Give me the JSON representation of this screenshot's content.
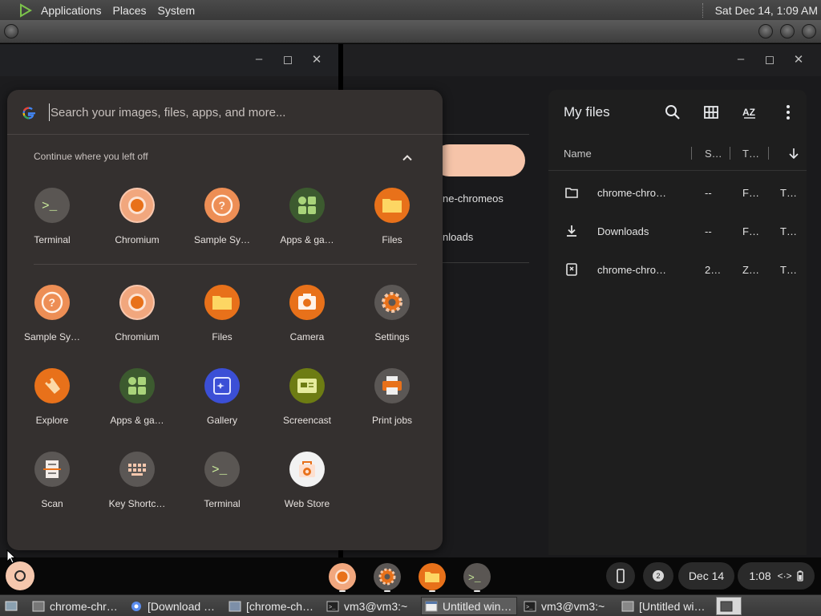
{
  "top_panel": {
    "menus": [
      "Applications",
      "Places",
      "System"
    ],
    "clock": "Sat Dec 14,  1:09 AM"
  },
  "launcher": {
    "search_placeholder": "Search your images, files, apps, and more...",
    "continue_label": "Continue where you left off",
    "continue_apps": [
      {
        "label": "Terminal",
        "icon": "terminal-icon"
      },
      {
        "label": "Chromium",
        "icon": "chromium-icon"
      },
      {
        "label": "Sample Sy…",
        "icon": "help-icon"
      },
      {
        "label": "Apps & ga…",
        "icon": "apps-games-icon"
      },
      {
        "label": "Files",
        "icon": "files-icon"
      }
    ],
    "apps": [
      {
        "label": "Sample Sy…",
        "icon": "help-icon"
      },
      {
        "label": "Chromium",
        "icon": "chromium-icon"
      },
      {
        "label": "Files",
        "icon": "files-icon"
      },
      {
        "label": "Camera",
        "icon": "camera-icon"
      },
      {
        "label": "Settings",
        "icon": "settings-icon"
      },
      {
        "label": "Explore",
        "icon": "explore-icon"
      },
      {
        "label": "Apps & ga…",
        "icon": "apps-games-icon"
      },
      {
        "label": "Gallery",
        "icon": "gallery-icon"
      },
      {
        "label": "Screencast",
        "icon": "screencast-icon"
      },
      {
        "label": "Print jobs",
        "icon": "print-icon"
      },
      {
        "label": "Scan",
        "icon": "scan-icon"
      },
      {
        "label": "Key Shortc…",
        "icon": "keyboard-icon"
      },
      {
        "label": "Terminal",
        "icon": "terminal-icon"
      },
      {
        "label": "Web Store",
        "icon": "web-store-icon"
      }
    ]
  },
  "middle_window": {
    "text1": "ne-chromeos",
    "text2": "nloads"
  },
  "files_window": {
    "title": "My files",
    "columns": [
      "Name",
      "S…",
      "T…"
    ],
    "rows": [
      {
        "name": "chrome-chro…",
        "size": "--",
        "type": "F…",
        "date": "T…",
        "icon": "folder-icon"
      },
      {
        "name": "Downloads",
        "size": "--",
        "type": "F…",
        "date": "T…",
        "icon": "download-icon"
      },
      {
        "name": "chrome-chro…",
        "size": "2…",
        "type": "Z…",
        "date": "T…",
        "icon": "zip-icon"
      }
    ]
  },
  "shelf": {
    "notification_count": "2",
    "date": "Dec 14",
    "time": "1:08"
  },
  "taskbar": {
    "tasks": [
      {
        "label": "chrome-chr…"
      },
      {
        "label": "[Download …"
      },
      {
        "label": "[chrome-ch…"
      },
      {
        "label": "vm3@vm3:~"
      },
      {
        "label": "Untitled win…"
      },
      {
        "label": "vm3@vm3:~"
      },
      {
        "label": "[Untitled wi…"
      }
    ]
  },
  "colors": {
    "launcher_bg": "#34302f",
    "accent_orange": "#e8711a",
    "pill": "#f6c4a9"
  }
}
